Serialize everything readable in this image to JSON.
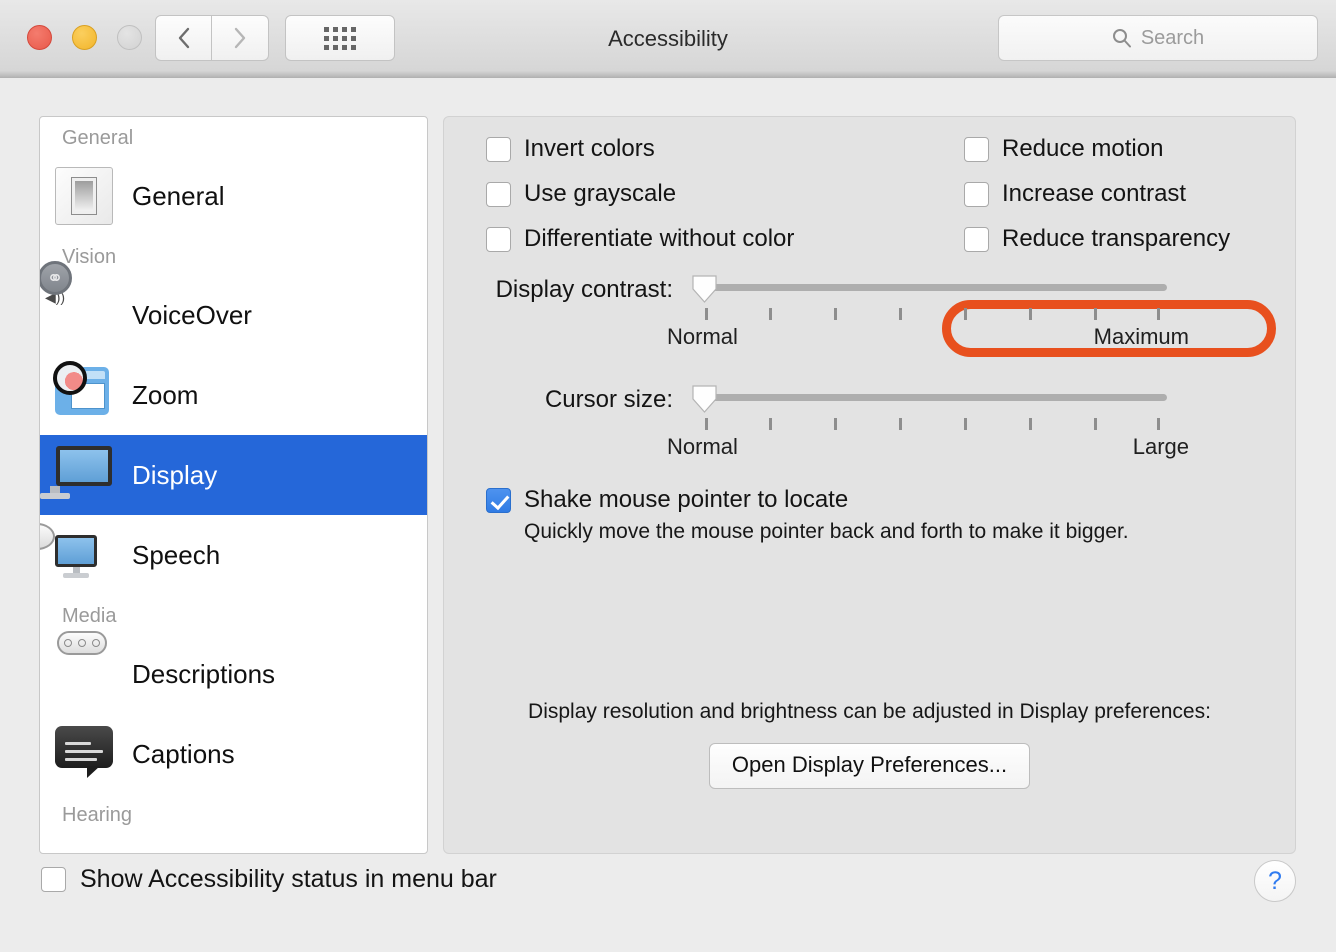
{
  "window": {
    "title": "Accessibility",
    "traffic_lights": [
      "close",
      "minimize",
      "zoom-disabled"
    ],
    "nav": {
      "back": "back-arrow",
      "forward": "forward-arrow",
      "grid": "show-all-grid"
    },
    "search": {
      "placeholder": "Search",
      "value": "",
      "icon": "search-icon"
    }
  },
  "sidebar": {
    "groups": [
      {
        "heading": "General",
        "items": [
          {
            "label": "General",
            "icon": "light-switch-icon",
            "selected": false
          }
        ]
      },
      {
        "heading": "Vision",
        "items": [
          {
            "label": "VoiceOver",
            "icon": "voiceover-icon",
            "selected": false
          },
          {
            "label": "Zoom",
            "icon": "zoom-magnifier-icon",
            "selected": false
          },
          {
            "label": "Display",
            "icon": "display-monitor-icon",
            "selected": true
          },
          {
            "label": "Speech",
            "icon": "speech-bubble-icon",
            "selected": false
          }
        ]
      },
      {
        "heading": "Media",
        "items": [
          {
            "label": "Descriptions",
            "icon": "descriptions-icon",
            "selected": false
          },
          {
            "label": "Captions",
            "icon": "captions-icon",
            "selected": false
          }
        ]
      },
      {
        "heading": "Hearing",
        "items": []
      }
    ]
  },
  "main": {
    "checkboxes_left": [
      {
        "label": "Invert colors",
        "checked": false
      },
      {
        "label": "Use grayscale",
        "checked": false
      },
      {
        "label": "Differentiate without color",
        "checked": false
      }
    ],
    "checkboxes_right": [
      {
        "label": "Reduce motion",
        "checked": false
      },
      {
        "label": "Increase contrast",
        "checked": false
      },
      {
        "label": "Reduce transparency",
        "checked": false,
        "highlighted": true
      }
    ],
    "sliders": [
      {
        "label": "Display contrast:",
        "min_label": "Normal",
        "max_label": "Maximum",
        "value": 0,
        "ticks": 8
      },
      {
        "label": "Cursor size:",
        "min_label": "Normal",
        "max_label": "Large",
        "value": 0,
        "ticks": 8
      }
    ],
    "shake": {
      "label": "Shake mouse pointer to locate",
      "checked": true,
      "description": "Quickly move the mouse pointer back and forth to make it bigger."
    },
    "footer": {
      "text": "Display resolution and brightness can be adjusted in Display preferences:",
      "button": "Open Display Preferences..."
    }
  },
  "bottom": {
    "status_checkbox": {
      "label": "Show Accessibility status in menu bar",
      "checked": false
    },
    "help_button": "?"
  },
  "colors": {
    "accent_selected": "#2567d9",
    "checkbox_checked": "#2f7be4",
    "annotation": "#e8501e",
    "panel_bg": "#e3e3e3",
    "window_bg": "#ececec"
  }
}
